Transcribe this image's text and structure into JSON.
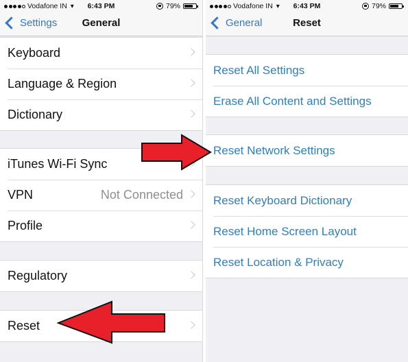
{
  "status_bar": {
    "carrier": "Vodafone IN",
    "signal_bars_filled": 4,
    "signal_bars_total": 5,
    "time": "6:43 PM",
    "battery_percent_label": "79%",
    "battery_level": 0.79
  },
  "left_screen": {
    "nav": {
      "back_label": "Settings",
      "title": "General"
    },
    "groups": [
      {
        "rows": [
          {
            "label": "Keyboard"
          },
          {
            "label": "Language & Region"
          },
          {
            "label": "Dictionary"
          }
        ]
      },
      {
        "rows": [
          {
            "label": "iTunes Wi-Fi Sync"
          },
          {
            "label": "VPN",
            "value": "Not Connected"
          },
          {
            "label": "Profile"
          }
        ]
      },
      {
        "rows": [
          {
            "label": "Regulatory"
          }
        ]
      },
      {
        "rows": [
          {
            "label": "Reset"
          }
        ]
      }
    ]
  },
  "right_screen": {
    "nav": {
      "back_label": "General",
      "title": "Reset"
    },
    "groups": [
      {
        "rows": [
          {
            "label": "Reset All Settings"
          },
          {
            "label": "Erase All Content and Settings"
          }
        ]
      },
      {
        "rows": [
          {
            "label": "Reset Network Settings"
          }
        ]
      },
      {
        "rows": [
          {
            "label": "Reset Keyboard Dictionary"
          },
          {
            "label": "Reset Home Screen Layout"
          },
          {
            "label": "Reset Location & Privacy"
          }
        ]
      }
    ]
  },
  "annotations": {
    "arrow_color": "#e8202a",
    "arrows": [
      {
        "points_to": "Reset Network Settings",
        "direction": "right"
      },
      {
        "points_to": "Reset",
        "direction": "left"
      }
    ]
  },
  "colors": {
    "link_blue": "#2f7fc0",
    "nav_back_blue": "#3478c6",
    "background_gray": "#efeff4",
    "value_gray": "#8e8e93"
  }
}
